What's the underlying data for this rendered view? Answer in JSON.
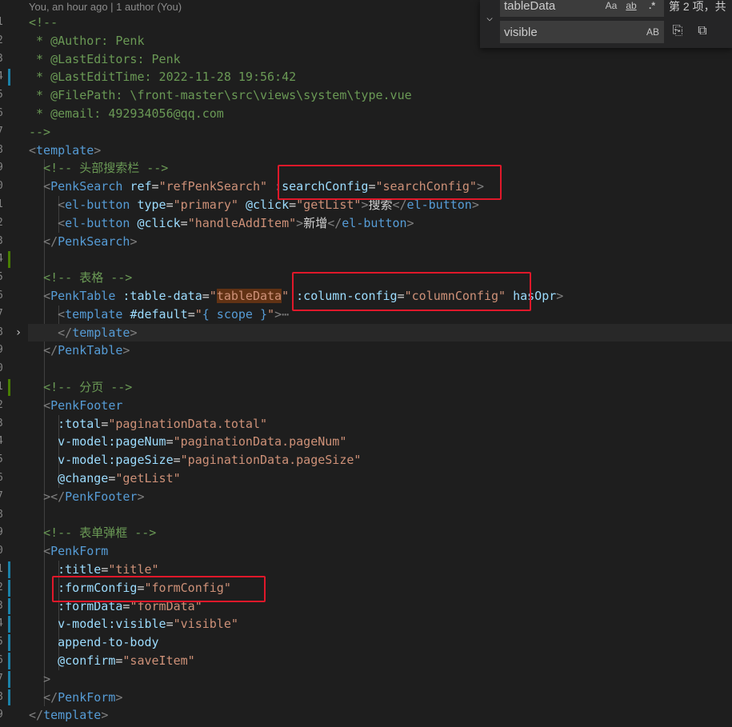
{
  "editor": {
    "blame_text": "You, an hour ago | 1 author (You)",
    "line_number_suffixes": [
      "1",
      "2",
      "3",
      "4",
      "5",
      "6",
      "7",
      "8",
      "9",
      "0",
      "1",
      "2",
      "3",
      "4",
      "5",
      "6",
      "7",
      "8",
      "9",
      "0",
      "1",
      "2",
      "3",
      "4",
      "5",
      "6",
      "7",
      "8",
      "9",
      "0",
      "1",
      "2",
      "3",
      "4",
      "5",
      "6",
      "7",
      "8",
      "9"
    ],
    "current_line_index": 17,
    "folded_line_index": 17,
    "fold_arrow": "›",
    "modified_line_indices": [
      3,
      13,
      20,
      30,
      31,
      32,
      33,
      34,
      35,
      36,
      37
    ],
    "added_line_indices": [
      13,
      20
    ],
    "lines": [
      [
        [
          "cm",
          "<!--"
        ]
      ],
      [
        [
          "cm",
          " * @Author: Penk"
        ]
      ],
      [
        [
          "cm",
          " * @LastEditors: Penk"
        ]
      ],
      [
        [
          "cm",
          " * @LastEditTime: 2022-11-28 19:56:42"
        ]
      ],
      [
        [
          "cm",
          " * @FilePath: \\front-master\\src\\views\\system\\type.vue"
        ]
      ],
      [
        [
          "cm",
          " * @email: 492934056@qq.com"
        ]
      ],
      [
        [
          "cm",
          "-->"
        ]
      ],
      [
        [
          "br",
          "<"
        ],
        [
          "tag",
          "template"
        ],
        [
          "br",
          ">"
        ]
      ],
      [
        [
          "tx",
          "  "
        ],
        [
          "cm",
          "<!-- 头部搜索栏 -->"
        ]
      ],
      [
        [
          "tx",
          "  "
        ],
        [
          "br",
          "<"
        ],
        [
          "tag",
          "PenkSearch"
        ],
        [
          "tx",
          " "
        ],
        [
          "at",
          "ref"
        ],
        [
          "tx",
          "="
        ],
        [
          "st",
          "\"refPenkSearch\""
        ],
        [
          "tx",
          " "
        ],
        [
          "at",
          ":searchConfig"
        ],
        [
          "tx",
          "="
        ],
        [
          "st",
          "\"searchConfig\""
        ],
        [
          "br",
          ">"
        ]
      ],
      [
        [
          "tx",
          "    "
        ],
        [
          "br",
          "<"
        ],
        [
          "tag",
          "el-button"
        ],
        [
          "tx",
          " "
        ],
        [
          "at",
          "type"
        ],
        [
          "tx",
          "="
        ],
        [
          "st",
          "\"primary\""
        ],
        [
          "tx",
          " "
        ],
        [
          "at",
          "@click"
        ],
        [
          "tx",
          "="
        ],
        [
          "st",
          "\"getList\""
        ],
        [
          "br",
          ">"
        ],
        [
          "tx",
          "搜索"
        ],
        [
          "br",
          "</"
        ],
        [
          "tag",
          "el-button"
        ],
        [
          "br",
          ">"
        ]
      ],
      [
        [
          "tx",
          "    "
        ],
        [
          "br",
          "<"
        ],
        [
          "tag",
          "el-button"
        ],
        [
          "tx",
          " "
        ],
        [
          "at",
          "@click"
        ],
        [
          "tx",
          "="
        ],
        [
          "st",
          "\"handleAddItem\""
        ],
        [
          "br",
          ">"
        ],
        [
          "tx",
          "新增"
        ],
        [
          "br",
          "</"
        ],
        [
          "tag",
          "el-button"
        ],
        [
          "br",
          ">"
        ]
      ],
      [
        [
          "tx",
          "  "
        ],
        [
          "br",
          "</"
        ],
        [
          "tag",
          "PenkSearch"
        ],
        [
          "br",
          ">"
        ]
      ],
      [],
      [
        [
          "tx",
          "  "
        ],
        [
          "cm",
          "<!-- 表格 -->"
        ]
      ],
      [
        [
          "tx",
          "  "
        ],
        [
          "br",
          "<"
        ],
        [
          "tag",
          "PenkTable"
        ],
        [
          "tx",
          " "
        ],
        [
          "at",
          ":table-data"
        ],
        [
          "tx",
          "="
        ],
        [
          "st",
          "\""
        ],
        [
          "sthl",
          "tableData"
        ],
        [
          "st",
          "\""
        ],
        [
          "tx",
          " "
        ],
        [
          "at",
          ":column-config"
        ],
        [
          "tx",
          "="
        ],
        [
          "st",
          "\"columnConfig\""
        ],
        [
          "tx",
          " "
        ],
        [
          "at",
          "hasOpr"
        ],
        [
          "br",
          ">"
        ]
      ],
      [
        [
          "tx",
          "    "
        ],
        [
          "br",
          "<"
        ],
        [
          "tag",
          "template"
        ],
        [
          "tx",
          " "
        ],
        [
          "at",
          "#default"
        ],
        [
          "tx",
          "="
        ],
        [
          "st",
          "\""
        ],
        [
          "tag",
          "{ scope }"
        ],
        [
          "st",
          "\""
        ],
        [
          "br",
          ">"
        ],
        [
          "dots",
          "⋯"
        ]
      ],
      [
        [
          "tx",
          "    "
        ],
        [
          "br",
          "</"
        ],
        [
          "tag",
          "template"
        ],
        [
          "br",
          ">"
        ]
      ],
      [
        [
          "tx",
          "  "
        ],
        [
          "br",
          "</"
        ],
        [
          "tag",
          "PenkTable"
        ],
        [
          "br",
          ">"
        ]
      ],
      [],
      [
        [
          "tx",
          "  "
        ],
        [
          "cm",
          "<!-- 分页 -->"
        ]
      ],
      [
        [
          "tx",
          "  "
        ],
        [
          "br",
          "<"
        ],
        [
          "tag",
          "PenkFooter"
        ]
      ],
      [
        [
          "tx",
          "    "
        ],
        [
          "at",
          ":total"
        ],
        [
          "tx",
          "="
        ],
        [
          "st",
          "\"paginationData.total\""
        ]
      ],
      [
        [
          "tx",
          "    "
        ],
        [
          "at",
          "v-model:pageNum"
        ],
        [
          "tx",
          "="
        ],
        [
          "st",
          "\"paginationData.pageNum\""
        ]
      ],
      [
        [
          "tx",
          "    "
        ],
        [
          "at",
          "v-model:pageSize"
        ],
        [
          "tx",
          "="
        ],
        [
          "st",
          "\"paginationData.pageSize\""
        ]
      ],
      [
        [
          "tx",
          "    "
        ],
        [
          "at",
          "@change"
        ],
        [
          "tx",
          "="
        ],
        [
          "st",
          "\"getList\""
        ]
      ],
      [
        [
          "tx",
          "  "
        ],
        [
          "br",
          "></"
        ],
        [
          "tag",
          "PenkFooter"
        ],
        [
          "br",
          ">"
        ]
      ],
      [],
      [
        [
          "tx",
          "  "
        ],
        [
          "cm",
          "<!-- 表单弹框 -->"
        ]
      ],
      [
        [
          "tx",
          "  "
        ],
        [
          "br",
          "<"
        ],
        [
          "tag",
          "PenkForm"
        ]
      ],
      [
        [
          "tx",
          "    "
        ],
        [
          "at",
          ":title"
        ],
        [
          "tx",
          "="
        ],
        [
          "st",
          "\"title\""
        ]
      ],
      [
        [
          "tx",
          "    "
        ],
        [
          "at",
          ":formConfig"
        ],
        [
          "tx",
          "="
        ],
        [
          "st",
          "\"formConfig\""
        ]
      ],
      [
        [
          "tx",
          "    "
        ],
        [
          "at",
          ":formData"
        ],
        [
          "tx",
          "="
        ],
        [
          "st",
          "\"formData\""
        ]
      ],
      [
        [
          "tx",
          "    "
        ],
        [
          "at",
          "v-model:visible"
        ],
        [
          "tx",
          "="
        ],
        [
          "st",
          "\"visible\""
        ]
      ],
      [
        [
          "tx",
          "    "
        ],
        [
          "at",
          "append-to-body"
        ]
      ],
      [
        [
          "tx",
          "    "
        ],
        [
          "at",
          "@confirm"
        ],
        [
          "tx",
          "="
        ],
        [
          "st",
          "\"saveItem\""
        ]
      ],
      [
        [
          "tx",
          "  "
        ],
        [
          "br",
          ">"
        ]
      ],
      [
        [
          "tx",
          "  "
        ],
        [
          "br",
          "</"
        ],
        [
          "tag",
          "PenkForm"
        ],
        [
          "br",
          ">"
        ]
      ],
      [
        [
          "br",
          "</"
        ],
        [
          "tag",
          "template"
        ],
        [
          "br",
          ">"
        ]
      ]
    ]
  },
  "annotations": [
    "searchConfig-highlight-box",
    "column-config-highlight-box",
    "formConfig-highlight-box"
  ],
  "find_widget": {
    "toggle_icon": "chevron-down",
    "find_value": "tableData",
    "replace_value": "visible",
    "match_case_label": "Aa",
    "whole_word_label": "ab",
    "regex_label": ".*",
    "preserve_case_label": "AB",
    "result_text": "第 2 项，共"
  },
  "colors": {
    "background": "#1e1e1e",
    "annotation_box": "#e0182a",
    "find_highlight": "#613214"
  }
}
